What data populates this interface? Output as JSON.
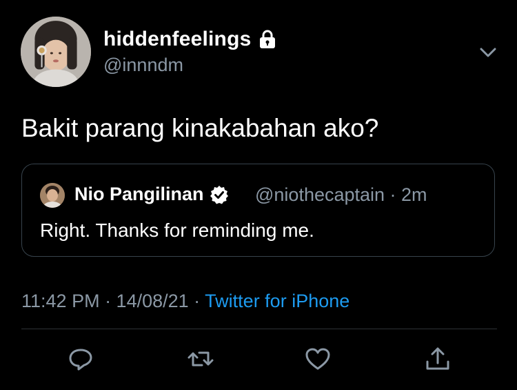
{
  "tweet": {
    "display_name": "hiddenfeelings",
    "handle": "@innndm",
    "text": "Bakit parang kinakabahan ako?",
    "locked_icon": "lock-icon",
    "timestamp": "11:42 PM · 14/08/21 · ",
    "source": "Twitter for iPhone"
  },
  "quote": {
    "display_name": "Nio Pangilinan",
    "handle_time": "@niothecaptain · 2m",
    "text": "Right. Thanks for reminding me.",
    "verified_icon": "verified-badge-icon"
  },
  "actions": {
    "reply_icon": "reply-icon",
    "retweet_icon": "retweet-icon",
    "like_icon": "heart-icon",
    "share_icon": "share-icon"
  },
  "colors": {
    "background": "#000000",
    "text": "#ffffff",
    "secondary": "#8b98a5",
    "accent": "#1d9bf0",
    "border": "#38444d"
  }
}
